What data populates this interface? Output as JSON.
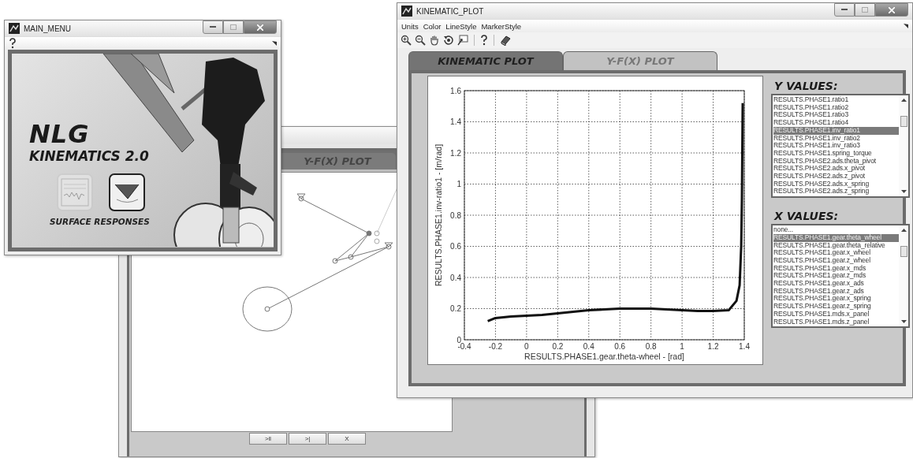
{
  "back_window": {
    "tab": {
      "label": "Y-F(X) PLOT"
    },
    "buttons": [
      ">‖",
      ">|",
      "X"
    ]
  },
  "main_menu": {
    "title": "MAIN_MENU",
    "logo_line1": "NLG",
    "logo_line2": "KINEMATICS 2.0",
    "tools": [
      {
        "kind": "curve",
        "disabled": true
      },
      {
        "kind": "surface",
        "disabled": false
      }
    ],
    "tools_label": "SURFACE RESPONSES"
  },
  "kinematic_plot": {
    "title": "KINEMATIC_PLOT",
    "menus": [
      "Units",
      "Color",
      "LineStyle",
      "MarkerStyle"
    ],
    "tabs": [
      {
        "label": "KINEMATIC PLOT",
        "selected": true
      },
      {
        "label": "Y-F(X) PLOT",
        "selected": false
      }
    ],
    "chart_data": {
      "type": "line",
      "xlabel": "RESULTS.PHASE1.gear.theta-wheel - [rad]",
      "ylabel": "RESULTS.PHASE1.inv-ratio1 - [m/rad]",
      "x": [
        -0.25,
        -0.2,
        -0.1,
        0,
        0.1,
        0.2,
        0.3,
        0.4,
        0.5,
        0.6,
        0.7,
        0.8,
        0.9,
        1.0,
        1.1,
        1.2,
        1.3,
        1.35,
        1.37,
        1.38,
        1.385,
        1.39
      ],
      "grid": true,
      "series": [
        {
          "color": "#111111",
          "values": [
            0.12,
            0.14,
            0.15,
            0.155,
            0.16,
            0.17,
            0.18,
            0.19,
            0.195,
            0.2,
            0.2,
            0.2,
            0.195,
            0.19,
            0.185,
            0.185,
            0.19,
            0.25,
            0.35,
            0.6,
            0.9,
            1.52
          ]
        }
      ],
      "xlim": [
        -0.4,
        1.4
      ],
      "ylim": [
        0,
        1.6
      ],
      "xticks": [
        -0.4,
        -0.2,
        0,
        0.2,
        0.4,
        0.6,
        0.8,
        1,
        1.2,
        1.4
      ],
      "yticks": [
        0,
        0.2,
        0.4,
        0.6,
        0.8,
        1,
        1.2,
        1.4,
        1.6
      ]
    },
    "y_values": {
      "heading": "Y VALUES:",
      "items": [
        {
          "label": "RESULTS.PHASE1.ratio1",
          "selected": false
        },
        {
          "label": "RESULTS.PHASE1.ratio2",
          "selected": false
        },
        {
          "label": "RESULTS.PHASE1.ratio3",
          "selected": false
        },
        {
          "label": "RESULTS.PHASE1.ratio4",
          "selected": false
        },
        {
          "label": "RESULTS.PHASE1.inv_ratio1",
          "selected": true
        },
        {
          "label": "RESULTS.PHASE1.inv_ratio2",
          "selected": false
        },
        {
          "label": "RESULTS.PHASE1.inv_ratio3",
          "selected": false
        },
        {
          "label": "RESULTS.PHASE1.spring_torque",
          "selected": false
        },
        {
          "label": "RESULTS.PHASE2.ads.theta_pivot",
          "selected": false
        },
        {
          "label": "RESULTS.PHASE2.ads.x_pivot",
          "selected": false
        },
        {
          "label": "RESULTS.PHASE2.ads.z_pivot",
          "selected": false
        },
        {
          "label": "RESULTS.PHASE2.ads.x_spring",
          "selected": false
        },
        {
          "label": "RESULTS.PHASE2.ads.z_spring",
          "selected": false
        }
      ]
    },
    "x_values": {
      "heading": "X VALUES:",
      "items": [
        {
          "label": "none...",
          "selected": false
        },
        {
          "label": "RESULTS.PHASE1.gear.theta_wheel",
          "selected": true
        },
        {
          "label": "RESULTS.PHASE1.gear.theta_relative",
          "selected": false
        },
        {
          "label": "RESULTS.PHASE1.gear.x_wheel",
          "selected": false
        },
        {
          "label": "RESULTS.PHASE1.gear.z_wheel",
          "selected": false
        },
        {
          "label": "RESULTS.PHASE1.gear.x_mds",
          "selected": false
        },
        {
          "label": "RESULTS.PHASE1.gear.z_mds",
          "selected": false
        },
        {
          "label": "RESULTS.PHASE1.gear.x_ads",
          "selected": false
        },
        {
          "label": "RESULTS.PHASE1.gear.z_ads",
          "selected": false
        },
        {
          "label": "RESULTS.PHASE1.gear.x_spring",
          "selected": false
        },
        {
          "label": "RESULTS.PHASE1.gear.z_spring",
          "selected": false
        },
        {
          "label": "RESULTS.PHASE1.mds.x_panel",
          "selected": false
        },
        {
          "label": "RESULTS.PHASE1.mds.z_panel",
          "selected": false
        }
      ]
    }
  }
}
